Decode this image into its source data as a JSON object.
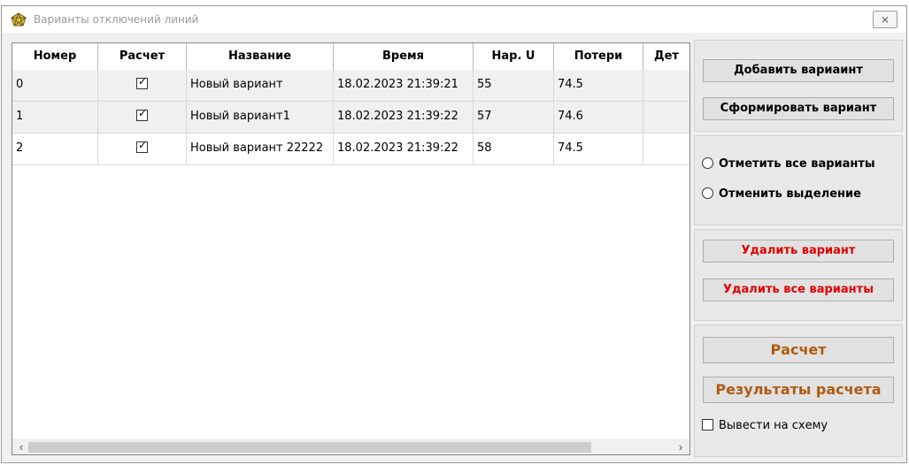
{
  "window": {
    "title": "Варианты отключений линий",
    "close_label": "⨯"
  },
  "grid": {
    "columns": [
      "Номер",
      "Расчет",
      "Название",
      "Время",
      "Нар. U",
      "Потери",
      "Дет"
    ],
    "rows": [
      {
        "number": "0",
        "calc_checked": true,
        "name": "Новый вариант",
        "time": "18.02.2023 21:39:21",
        "u": "55",
        "loss": "74.5"
      },
      {
        "number": "1",
        "calc_checked": true,
        "name": "Новый вариант1",
        "time": "18.02.2023 21:39:22",
        "u": "57",
        "loss": "74.6"
      },
      {
        "number": "2",
        "calc_checked": true,
        "name": "Новый вариант 22222",
        "time": "18.02.2023 21:39:22",
        "u": "58",
        "loss": "74.5"
      }
    ],
    "scroll_left_icon": "‹",
    "scroll_right_icon": "›"
  },
  "panel": {
    "add_variant": "Добавить вариаинт",
    "form_variant": "Сформировать вариант",
    "mark_all": "Отметить все варианты",
    "unselect": "Отменить выделение",
    "delete_variant": "Удалить вариант",
    "delete_all": "Удалить все варианты",
    "calc": "Расчет",
    "results": "Результаты расчета",
    "show_on_scheme": "Вывести на схему"
  },
  "colors": {
    "delete_text": "#e00000",
    "calc_text": "#b05a10"
  }
}
